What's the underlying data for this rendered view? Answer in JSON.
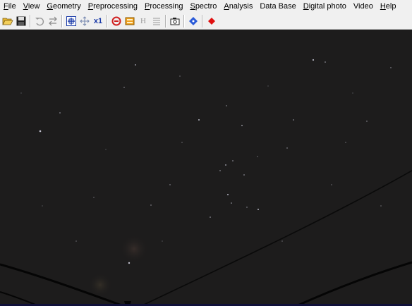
{
  "menu": [
    {
      "name": "menu-file",
      "first": "F",
      "rest": "ile"
    },
    {
      "name": "menu-view",
      "first": "V",
      "rest": "iew"
    },
    {
      "name": "menu-geometry",
      "first": "G",
      "rest": "eometry"
    },
    {
      "name": "menu-preprocessing",
      "first": "P",
      "rest": "reprocessing"
    },
    {
      "name": "menu-processing",
      "first": "P",
      "rest": "rocessing"
    },
    {
      "name": "menu-spectro",
      "first": "S",
      "rest": "pectro"
    },
    {
      "name": "menu-analysis",
      "first": "A",
      "rest": "nalysis"
    },
    {
      "name": "menu-database",
      "first": "",
      "rest": "Data Base"
    },
    {
      "name": "menu-digital-photo",
      "first": "D",
      "rest": "igital photo"
    },
    {
      "name": "menu-video",
      "first": "",
      "rest": "Video"
    },
    {
      "name": "menu-help",
      "first": "H",
      "rest": "elp"
    }
  ],
  "toolbar": {
    "x1_label": "x1",
    "h_label": "H"
  },
  "icons": {
    "open": "open-folder-icon",
    "save": "save-disk-icon",
    "undo": "undo-icon",
    "swap": "swap-arrows-icon",
    "zoom_fit": "zoom-fit-icon",
    "move": "move-cross-icon",
    "zoom_1": "zoom-1x-icon",
    "red_circle": "red-eye-icon",
    "orange_rect": "frame-icon",
    "h_tool": "header-icon",
    "list": "list-icon",
    "camera": "camera-icon",
    "blue_diamond": "blue-diamond-icon",
    "red_dot": "red-dot-icon"
  },
  "colors": {
    "sky": "#1d1c1c",
    "cable": "#050505",
    "star": "#d8d8e8"
  }
}
